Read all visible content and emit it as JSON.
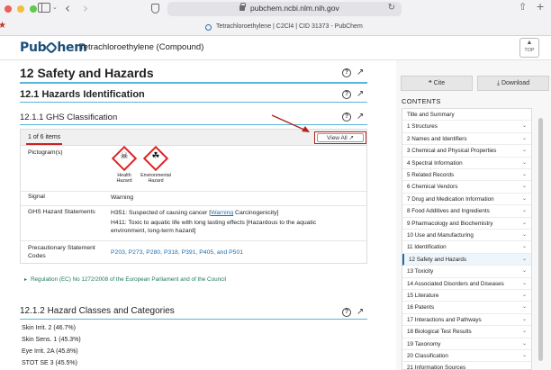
{
  "browser": {
    "url": "pubchem.ncbi.nlm.nih.gov",
    "tab_title": "Tetrachloroethylene | C2Cl4 | CID 31373 - PubChem"
  },
  "header": {
    "logo_left": "Pub",
    "logo_right": "hem",
    "compound": "Tetrachloroethylene (Compound)",
    "top_label": "TOP"
  },
  "section": {
    "title": "12 Safety and Hazards",
    "sub_title": "12.1 Hazards Identification",
    "subsub_title": "12.1.1 GHS Classification",
    "items_count": "1 of 6 items",
    "view_all": "View All",
    "rows": {
      "pictogram_label": "Pictogram(s)",
      "signal_label": "Signal",
      "signal_value": "Warning",
      "hazard_label": "GHS Hazard Statements",
      "h351_prefix": "H351: Suspected of causing cancer [",
      "h351_link": "Warning",
      "h351_suffix": " Carcinogenicity]",
      "h411_line1": "H411: Toxic to aquatic life with long lasting effects [Hazardous to the aquatic",
      "h411_line2": "environment, long-term hazard]",
      "precaution_label_1": "Precautionary Statement",
      "precaution_label_2": "Codes",
      "precaution_codes": "P203, P273, P280, P318, P391, P405, and P501"
    },
    "pictograms": [
      {
        "label_1": "Health",
        "label_2": "Hazard"
      },
      {
        "label_1": "Environmental",
        "label_2": "Hazard"
      }
    ],
    "regulation": "Regulation (EC) No 1272/2008 of the European Parliament and of the Council",
    "classes_title": "12.1.2 Hazard Classes and Categories",
    "classes": [
      "Skin Irrit. 2 (46.7%)",
      "Skin Sens. 1 (45.3%)",
      "Eye Irrit. 2A (45.8%)",
      "STOT SE 3 (45.5%)"
    ]
  },
  "right_panel": {
    "cite": "Cite",
    "download": "Download",
    "contents": "CONTENTS",
    "toc": [
      "Title and Summary",
      "1 Structures",
      "2 Names and Identifiers",
      "3 Chemical and Physical Properties",
      "4 Spectral Information",
      "5 Related Records",
      "6 Chemical Vendors",
      "7 Drug and Medication Information",
      "8 Food Additives and Ingredients",
      "9 Pharmacology and Biochemistry",
      "10 Use and Manufacturing",
      "11 Identification",
      "12 Safety and Hazards",
      "13 Toxicity",
      "14 Associated Disorders and Diseases",
      "15 Literature",
      "16 Patents",
      "17 Interactions and Pathways",
      "18 Biological Test Results",
      "19 Taxonomy",
      "20 Classification",
      "21 Information Sources"
    ],
    "active_index": 12
  }
}
